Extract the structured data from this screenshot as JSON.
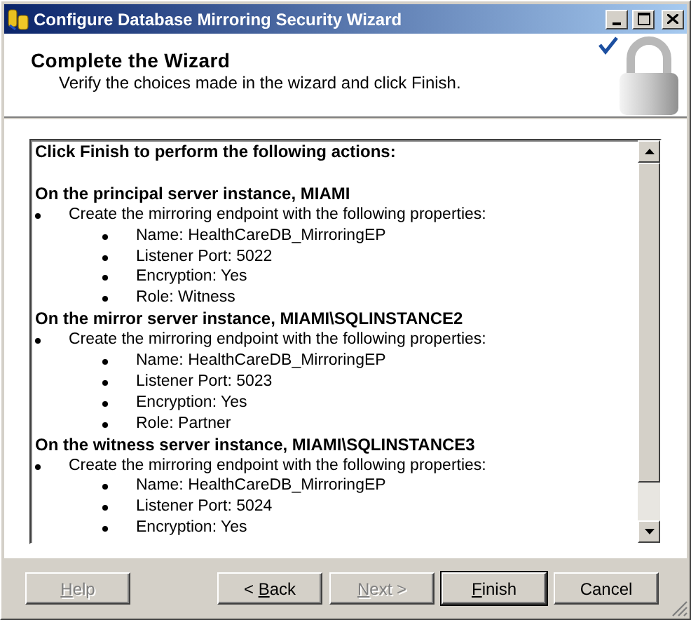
{
  "window": {
    "title": "Configure Database Mirroring Security Wizard"
  },
  "header": {
    "title": "Complete the Wizard",
    "subtitle": "Verify the choices made in the wizard and click Finish."
  },
  "summary": {
    "intro": "Click Finish to perform the following actions:",
    "sections": [
      {
        "heading": "On the principal server instance, MIAMI",
        "items": [
          {
            "text": "Create the mirroring endpoint with the following properties:",
            "children": [
              {
                "text": "Name: HealthCareDB_MirroringEP"
              },
              {
                "text": "Listener Port: 5022"
              },
              {
                "text": "Encryption: Yes"
              },
              {
                "text": "Role: Witness"
              }
            ]
          }
        ]
      },
      {
        "heading": "On the mirror server instance, MIAMI\\SQLINSTANCE2",
        "items": [
          {
            "text": "Create the mirroring endpoint with the following properties:",
            "children": [
              {
                "text": "Name: HealthCareDB_MirroringEP"
              },
              {
                "text": "Listener Port: 5023"
              },
              {
                "text": "Encryption: Yes"
              },
              {
                "text": "Role: Partner"
              }
            ]
          }
        ]
      },
      {
        "heading": "On the witness server instance, MIAMI\\SQLINSTANCE3",
        "items": [
          {
            "text": "Create the mirroring endpoint with the following properties:",
            "children": [
              {
                "text": "Name: HealthCareDB_MirroringEP"
              },
              {
                "text": "Listener Port: 5024"
              },
              {
                "text": "Encryption: Yes"
              }
            ]
          }
        ]
      }
    ]
  },
  "buttons": [
    {
      "label": {
        "key": "H",
        "after": "elp"
      },
      "disabled": true,
      "default": false
    },
    {
      "label": {
        "before": "< ",
        "key": "B",
        "after": "ack"
      },
      "disabled": false,
      "default": false
    },
    {
      "label": {
        "key": "N",
        "after": "ext >"
      },
      "disabled": true,
      "default": false
    },
    {
      "label": {
        "key": "F",
        "after": "inish"
      },
      "disabled": false,
      "default": true
    },
    {
      "label": {
        "before": "Cancel"
      },
      "disabled": false,
      "default": false
    }
  ]
}
